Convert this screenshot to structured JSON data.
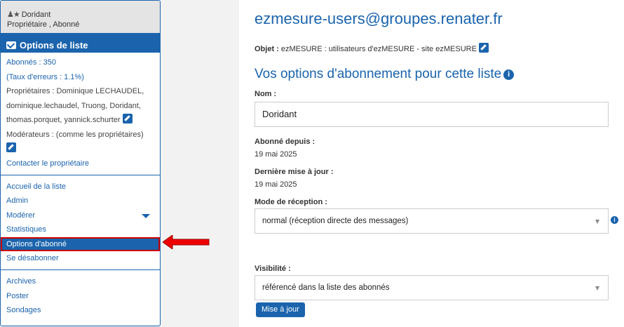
{
  "sidebar": {
    "user_name": "Doridant",
    "user_roles": "Propriétaire , Abonné",
    "options_header": "Options de liste",
    "subscribers": "Abonnés : 350",
    "error_rate": "(Taux d'erreurs : 1.1%)",
    "owners_line1": "Propriétaires : Dominique LECHAUDEL,",
    "owners_line2": "dominique.lechaudel, Truong, Doridant,",
    "owners_line3": "thomas.porquet, yannick.schurter",
    "moderators": "Modérateurs : (comme les propriétaires)",
    "contact_owner": "Contacter le propriétaire",
    "nav_group1": [
      "Accueil de la liste",
      "Admin",
      "Modérer",
      "Statistiques",
      "Options d'abonné",
      "Se désabonner"
    ],
    "nav_group2": [
      "Archives",
      "Poster",
      "Sondages"
    ]
  },
  "main": {
    "list_address": "ezmesure-users@groupes.renater.fr",
    "subject_label": "Objet :",
    "subject_value": "ezMESURE : utilisateurs d'ezMESURE - site ezMESURE",
    "section_title": "Vos options d'abonnement pour cette liste",
    "name_label": "Nom :",
    "name_value": "Doridant",
    "subscribed_since_label": "Abonné depuis :",
    "subscribed_since_value": "19 mai 2025",
    "last_update_label": "Dernière mise à jour :",
    "last_update_value": "19 mai 2025",
    "reception_label": "Mode de réception :",
    "reception_value": "normal (réception directe des messages)",
    "visibility_label": "Visibilité :",
    "visibility_value": "référencé dans la liste des abonnés",
    "update_button": "Mise à jour"
  },
  "colors": {
    "accent": "#1b64ad",
    "highlight": "#cc0000"
  }
}
